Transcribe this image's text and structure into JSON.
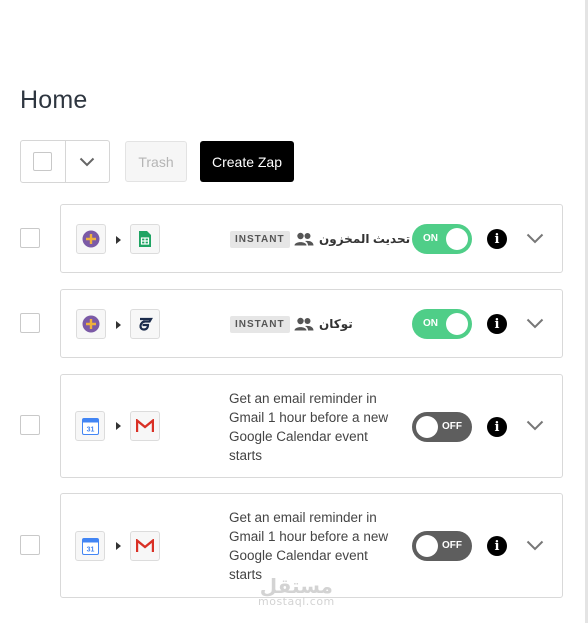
{
  "page": {
    "title": "Home"
  },
  "toolbar": {
    "trash_label": "Trash",
    "create_label": "Create Zap"
  },
  "zaps": [
    {
      "name": "تحديث المخزون",
      "badge": "INSTANT",
      "trigger_icon": "plus-circle-icon",
      "action_icon": "google-sheets-icon",
      "status": "ON",
      "enabled": true
    },
    {
      "name": "توكان",
      "badge": "INSTANT",
      "trigger_icon": "plus-circle-icon",
      "action_icon": "tookan-icon",
      "status": "ON",
      "enabled": true
    },
    {
      "description": "Get an email reminder in Gmail 1 hour before a new Google Calendar event starts",
      "trigger_icon": "google-calendar-icon",
      "calendar_day": "31",
      "action_icon": "gmail-icon",
      "status": "OFF",
      "enabled": false
    },
    {
      "description": "Get an email reminder in Gmail 1 hour before a new Google Calendar event starts",
      "trigger_icon": "google-calendar-icon",
      "calendar_day": "31",
      "action_icon": "gmail-icon",
      "status": "OFF",
      "enabled": false
    }
  ],
  "colors": {
    "toggle_on": "#4fce88",
    "toggle_off": "#5e5e5e",
    "primary_button": "#000000",
    "plus_circle_fill": "#7b5aa6",
    "plus_color": "#f0b13b",
    "sheets_green": "#1fa463",
    "gmail_red": "#d93025",
    "calendar_blue": "#4285f4"
  },
  "watermark": {
    "arabic": "مستقل",
    "latin": "mostaql.com"
  }
}
